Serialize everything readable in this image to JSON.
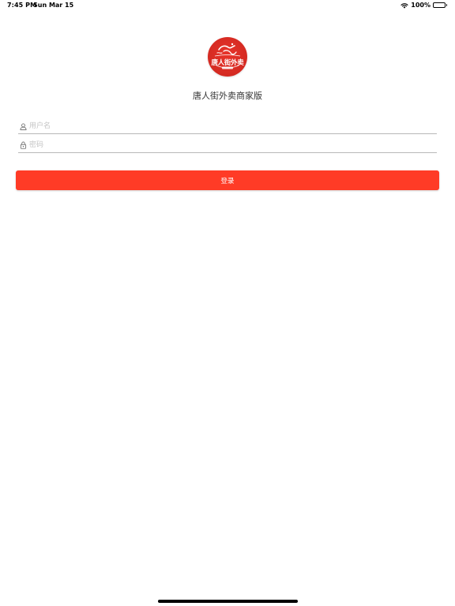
{
  "status_bar": {
    "time": "7:45 PM",
    "date": "Sun Mar 15",
    "battery": "100%",
    "icons": [
      "wifi-icon",
      "battery-icon"
    ]
  },
  "logo": {
    "text": "唐人街外卖",
    "background_color": "#d42a22"
  },
  "app_title": "唐人街外卖商家版",
  "form": {
    "username": {
      "placeholder": "用户名",
      "value": "",
      "icon": "user-icon"
    },
    "password": {
      "placeholder": "密码",
      "value": "",
      "icon": "lock-icon"
    },
    "login_label": "登录",
    "button_color": "#ff3b26"
  }
}
